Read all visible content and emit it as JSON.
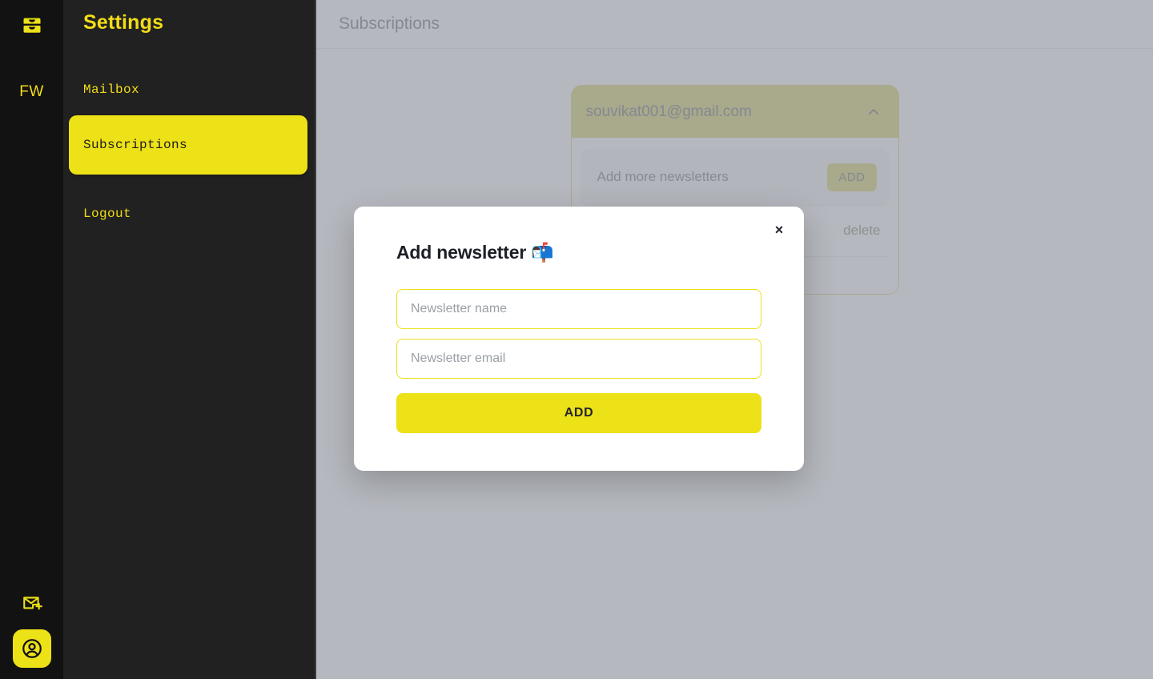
{
  "rail": {
    "logo_icon": "inbox-archive-icon",
    "brand_initials": "FW",
    "mail_add_icon": "mail-plus-icon",
    "account_icon": "user-circle-icon"
  },
  "sidebar": {
    "title": "Settings",
    "items": [
      {
        "label": "Mailbox",
        "active": false
      },
      {
        "label": "Subscriptions",
        "active": true
      },
      {
        "label": "Logout",
        "active": false
      }
    ]
  },
  "header": {
    "title": "Subscriptions"
  },
  "subscription_card": {
    "email": "souvikat001@gmail.com",
    "collapse_icon": "chevron-up-icon",
    "add_row": {
      "label": "Add more newsletters",
      "button_label": "ADD"
    },
    "newsletters": [
      {
        "name": "",
        "delete_label": "delete"
      }
    ]
  },
  "modal": {
    "title": "Add newsletter 📬",
    "close_label": "×",
    "close_icon": "close-icon",
    "name_placeholder": "Newsletter name",
    "name_value": "",
    "email_placeholder": "Newsletter email",
    "email_value": "",
    "submit_label": "ADD"
  },
  "colors": {
    "brand_yellow": "#EDE117",
    "brand_yellow_dim": "#C9BA1B",
    "rail_bg": "#121212",
    "panel_bg": "#212121",
    "overlay": "#A0A4AC"
  }
}
